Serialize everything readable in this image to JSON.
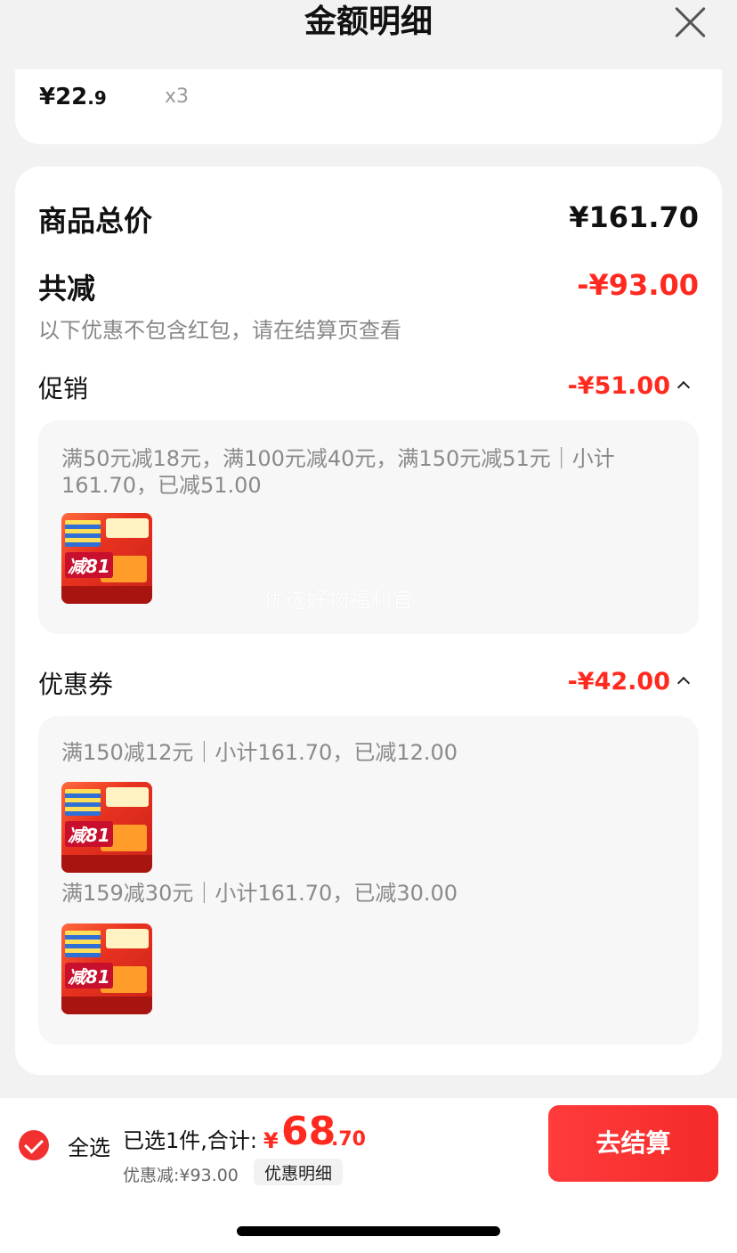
{
  "header": {
    "title": "金额明细"
  },
  "item": {
    "price_int": "¥22",
    "price_dec": ".9",
    "qty": "x3"
  },
  "summary": {
    "total_label": "商品总价",
    "total_value": "¥161.70",
    "reduce_label": "共减",
    "reduce_value": "-¥93.00",
    "note": "以下优惠不包含红包，请在结算页查看"
  },
  "promo": {
    "label": "促销",
    "value": "-¥51.00",
    "rule": "满50元减18元，满100元减40元，满150元减51元｜小计161.70，已减51.00",
    "watermark": "优选好物福利官"
  },
  "coupon": {
    "label": "优惠券",
    "value": "-¥42.00",
    "rules": [
      "满150减12元｜小计161.70，已减12.00",
      "满159减30元｜小计161.70，已减30.00"
    ]
  },
  "thumb": {
    "badge": "减81"
  },
  "footer": {
    "select_all": "全选",
    "summary": "已选1件,合计:",
    "total_symbol": "¥",
    "total_int": "68",
    "total_dec": ".70",
    "discount": "优惠减:¥93.00",
    "detail_button": "优惠明细",
    "checkout_button": "去结算"
  },
  "colors": {
    "accent": "#ff2a1f",
    "checkout": "#f52a2a"
  }
}
